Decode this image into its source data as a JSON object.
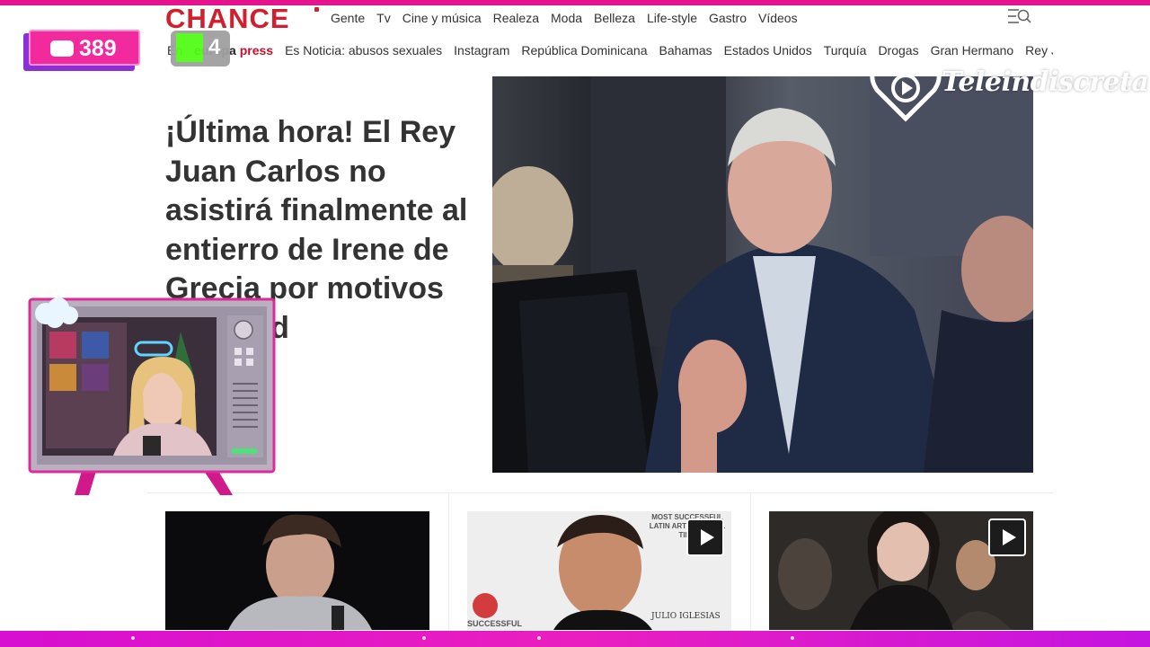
{
  "header": {
    "logo": "CHANCE",
    "nav": [
      "Gente",
      "Tv",
      "Cine y música",
      "Realeza",
      "Moda",
      "Belleza",
      "Life-style",
      "Gastro",
      "Vídeos"
    ],
    "menu_icon": "menu-search-icon"
  },
  "subnav": {
    "prefix": "En",
    "europa_press_part1": "europa ",
    "europa_press_part2": "press",
    "items": [
      "Es Noticia: abusos sexuales",
      "Instagram",
      "República Dominicana",
      "Bahamas",
      "Estados Unidos",
      "Turquía",
      "Drogas",
      "Gran Hermano",
      "Rey Juan Carlos"
    ]
  },
  "hero": {
    "headline": "¡Última hora! El Rey Juan Carlos no asistirá finalmente al entierro de Irene de Grecia por motivos de salud"
  },
  "cards": [
    {
      "has_video": false
    },
    {
      "has_video": true,
      "photo_text_top": "MOST SUCCESSFUL LATIN ARTIST OF ALL TIME",
      "photo_text_bottom": "JULIO IGLESIAS",
      "photo_text_left": "SUCCESSFUL"
    },
    {
      "has_video": true
    }
  ],
  "overlay": {
    "chat_count": "389",
    "kick_count": "4",
    "watermark": "Teleindiscreta"
  },
  "colors": {
    "logo_red": "#d0202f",
    "border_pink": "#e6138f",
    "overlay_pink": "#f22a9e",
    "overlay_purple": "#8b2fd6",
    "kick_green": "#53fc18"
  }
}
